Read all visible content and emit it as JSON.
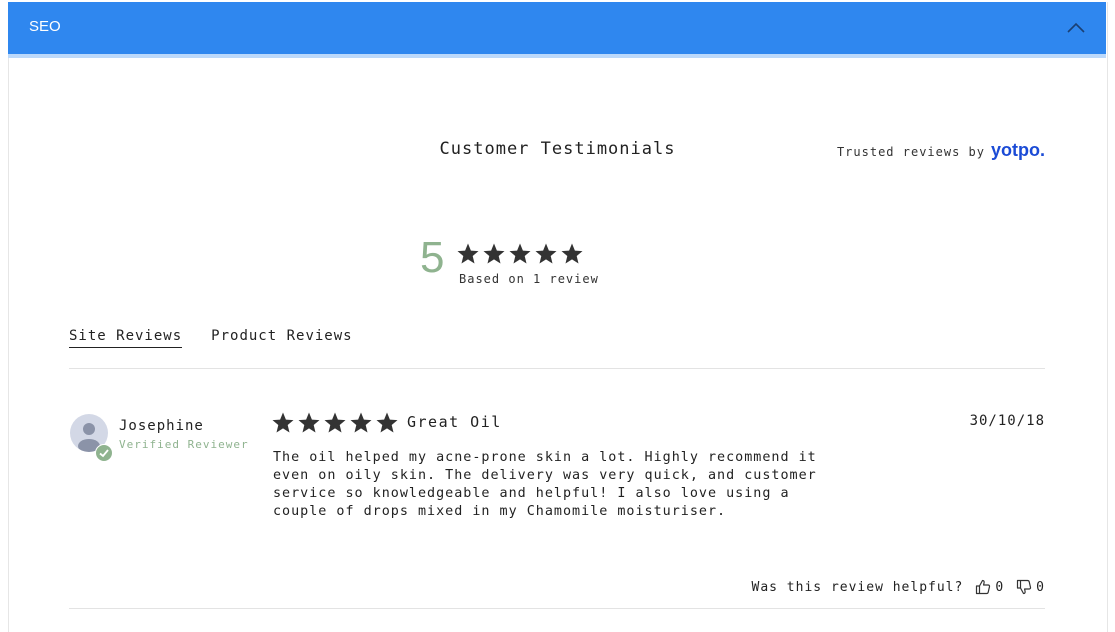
{
  "seo_section": {
    "title": "SEO",
    "collapse_icon": "chevron-up-icon"
  },
  "widget": {
    "heading": "Customer Testimonials",
    "trusted_prefix": "Trusted reviews by",
    "brand": "yotpo."
  },
  "summary": {
    "average_score": "5",
    "rating": 5,
    "based_on": "Based on 1 review"
  },
  "tabs": [
    {
      "label": "Site Reviews",
      "active": true
    },
    {
      "label": "Product Reviews",
      "active": false
    }
  ],
  "review": {
    "reviewer_name": "Josephine",
    "reviewer_status": "Verified Reviewer",
    "rating": 5,
    "title": "Great Oil",
    "date": "30/10/18",
    "body": "The oil helped my acne-prone skin a lot. Highly recommend it even on oily skin. The delivery was very quick, and customer service so knowledgeable and helpful! I also love using a couple of drops mixed in my Chamomile moisturiser.",
    "helpful_prompt": "Was this review helpful?",
    "thumbs_up_count": "0",
    "thumbs_down_count": "0"
  },
  "colors": {
    "seo_bar": "#2f87ef",
    "score": "#8fb38f",
    "brand": "#1b4bd6",
    "star": "#333333"
  }
}
